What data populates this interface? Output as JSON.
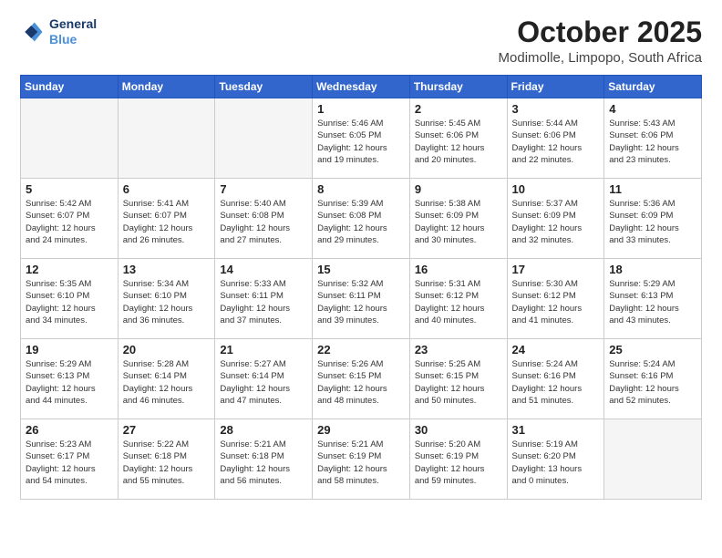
{
  "logo": {
    "line1": "General",
    "line2": "Blue"
  },
  "title": "October 2025",
  "location": "Modimolle, Limpopo, South Africa",
  "weekdays": [
    "Sunday",
    "Monday",
    "Tuesday",
    "Wednesday",
    "Thursday",
    "Friday",
    "Saturday"
  ],
  "weeks": [
    [
      {
        "day": "",
        "info": ""
      },
      {
        "day": "",
        "info": ""
      },
      {
        "day": "",
        "info": ""
      },
      {
        "day": "1",
        "info": "Sunrise: 5:46 AM\nSunset: 6:05 PM\nDaylight: 12 hours\nand 19 minutes."
      },
      {
        "day": "2",
        "info": "Sunrise: 5:45 AM\nSunset: 6:06 PM\nDaylight: 12 hours\nand 20 minutes."
      },
      {
        "day": "3",
        "info": "Sunrise: 5:44 AM\nSunset: 6:06 PM\nDaylight: 12 hours\nand 22 minutes."
      },
      {
        "day": "4",
        "info": "Sunrise: 5:43 AM\nSunset: 6:06 PM\nDaylight: 12 hours\nand 23 minutes."
      }
    ],
    [
      {
        "day": "5",
        "info": "Sunrise: 5:42 AM\nSunset: 6:07 PM\nDaylight: 12 hours\nand 24 minutes."
      },
      {
        "day": "6",
        "info": "Sunrise: 5:41 AM\nSunset: 6:07 PM\nDaylight: 12 hours\nand 26 minutes."
      },
      {
        "day": "7",
        "info": "Sunrise: 5:40 AM\nSunset: 6:08 PM\nDaylight: 12 hours\nand 27 minutes."
      },
      {
        "day": "8",
        "info": "Sunrise: 5:39 AM\nSunset: 6:08 PM\nDaylight: 12 hours\nand 29 minutes."
      },
      {
        "day": "9",
        "info": "Sunrise: 5:38 AM\nSunset: 6:09 PM\nDaylight: 12 hours\nand 30 minutes."
      },
      {
        "day": "10",
        "info": "Sunrise: 5:37 AM\nSunset: 6:09 PM\nDaylight: 12 hours\nand 32 minutes."
      },
      {
        "day": "11",
        "info": "Sunrise: 5:36 AM\nSunset: 6:09 PM\nDaylight: 12 hours\nand 33 minutes."
      }
    ],
    [
      {
        "day": "12",
        "info": "Sunrise: 5:35 AM\nSunset: 6:10 PM\nDaylight: 12 hours\nand 34 minutes."
      },
      {
        "day": "13",
        "info": "Sunrise: 5:34 AM\nSunset: 6:10 PM\nDaylight: 12 hours\nand 36 minutes."
      },
      {
        "day": "14",
        "info": "Sunrise: 5:33 AM\nSunset: 6:11 PM\nDaylight: 12 hours\nand 37 minutes."
      },
      {
        "day": "15",
        "info": "Sunrise: 5:32 AM\nSunset: 6:11 PM\nDaylight: 12 hours\nand 39 minutes."
      },
      {
        "day": "16",
        "info": "Sunrise: 5:31 AM\nSunset: 6:12 PM\nDaylight: 12 hours\nand 40 minutes."
      },
      {
        "day": "17",
        "info": "Sunrise: 5:30 AM\nSunset: 6:12 PM\nDaylight: 12 hours\nand 41 minutes."
      },
      {
        "day": "18",
        "info": "Sunrise: 5:29 AM\nSunset: 6:13 PM\nDaylight: 12 hours\nand 43 minutes."
      }
    ],
    [
      {
        "day": "19",
        "info": "Sunrise: 5:29 AM\nSunset: 6:13 PM\nDaylight: 12 hours\nand 44 minutes."
      },
      {
        "day": "20",
        "info": "Sunrise: 5:28 AM\nSunset: 6:14 PM\nDaylight: 12 hours\nand 46 minutes."
      },
      {
        "day": "21",
        "info": "Sunrise: 5:27 AM\nSunset: 6:14 PM\nDaylight: 12 hours\nand 47 minutes."
      },
      {
        "day": "22",
        "info": "Sunrise: 5:26 AM\nSunset: 6:15 PM\nDaylight: 12 hours\nand 48 minutes."
      },
      {
        "day": "23",
        "info": "Sunrise: 5:25 AM\nSunset: 6:15 PM\nDaylight: 12 hours\nand 50 minutes."
      },
      {
        "day": "24",
        "info": "Sunrise: 5:24 AM\nSunset: 6:16 PM\nDaylight: 12 hours\nand 51 minutes."
      },
      {
        "day": "25",
        "info": "Sunrise: 5:24 AM\nSunset: 6:16 PM\nDaylight: 12 hours\nand 52 minutes."
      }
    ],
    [
      {
        "day": "26",
        "info": "Sunrise: 5:23 AM\nSunset: 6:17 PM\nDaylight: 12 hours\nand 54 minutes."
      },
      {
        "day": "27",
        "info": "Sunrise: 5:22 AM\nSunset: 6:18 PM\nDaylight: 12 hours\nand 55 minutes."
      },
      {
        "day": "28",
        "info": "Sunrise: 5:21 AM\nSunset: 6:18 PM\nDaylight: 12 hours\nand 56 minutes."
      },
      {
        "day": "29",
        "info": "Sunrise: 5:21 AM\nSunset: 6:19 PM\nDaylight: 12 hours\nand 58 minutes."
      },
      {
        "day": "30",
        "info": "Sunrise: 5:20 AM\nSunset: 6:19 PM\nDaylight: 12 hours\nand 59 minutes."
      },
      {
        "day": "31",
        "info": "Sunrise: 5:19 AM\nSunset: 6:20 PM\nDaylight: 13 hours\nand 0 minutes."
      },
      {
        "day": "",
        "info": ""
      }
    ]
  ]
}
